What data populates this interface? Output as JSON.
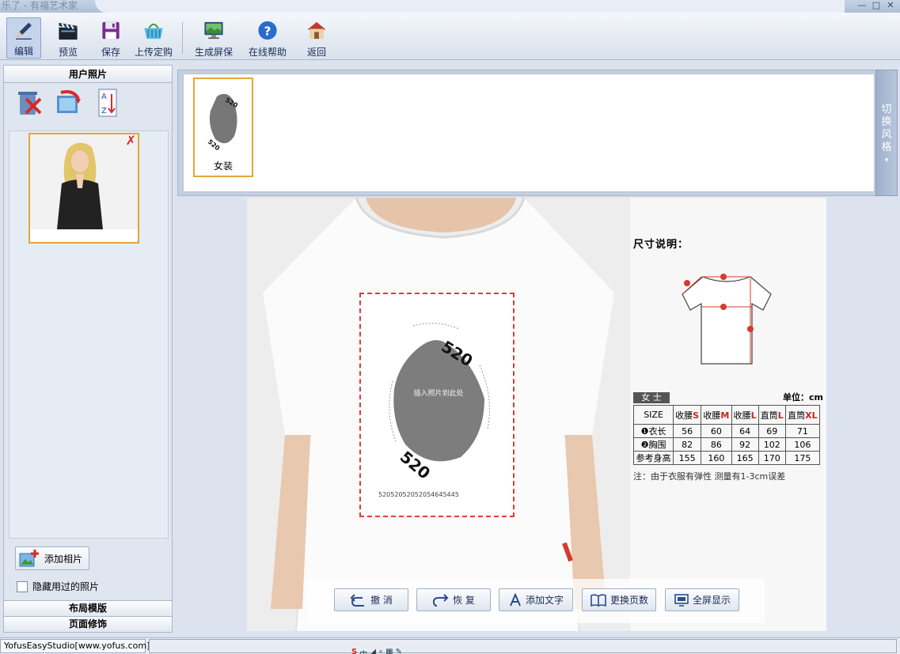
{
  "window": {
    "title": "乐了 - 有福艺术家"
  },
  "toolbar": {
    "items": [
      {
        "label": "编辑",
        "icon": "pencil-icon"
      },
      {
        "label": "预览",
        "icon": "clapper-icon"
      },
      {
        "label": "保存",
        "icon": "floppy-icon"
      },
      {
        "label": "上传定购",
        "icon": "basket-icon"
      },
      {
        "label": "生成屏保",
        "icon": "monitor-icon"
      },
      {
        "label": "在线帮助",
        "icon": "help-icon"
      },
      {
        "label": "返回",
        "icon": "home-icon"
      }
    ]
  },
  "left_panel": {
    "header": "用户照片",
    "add_photo_label": "添加相片",
    "hide_used_label": "隐藏用过的照片",
    "section_layout": "布局模版",
    "section_decor": "页面修饰"
  },
  "style_strip": {
    "thumb_label": "女装",
    "switch_label": [
      "切",
      "换",
      "风",
      "格"
    ]
  },
  "design": {
    "placeholder_text": "插入照片到此处",
    "deco_number": "520",
    "deco_digits": "52052052052054645445"
  },
  "size_chart": {
    "title": "尺寸说明：",
    "gender": "女 士",
    "unit": "单位：cm",
    "header": [
      {
        "text": "SIZE",
        "red": ""
      },
      {
        "text": "收腰",
        "red": "S"
      },
      {
        "text": "收腰",
        "red": "M"
      },
      {
        "text": "收腰",
        "red": "L"
      },
      {
        "text": "直筒",
        "red": "L"
      },
      {
        "text": "直筒",
        "red": "XL"
      }
    ],
    "rows": [
      {
        "name": "❶衣长",
        "values": [
          "56",
          "60",
          "64",
          "69",
          "71"
        ]
      },
      {
        "name": "❷胸围",
        "values": [
          "82",
          "86",
          "92",
          "102",
          "106"
        ]
      },
      {
        "name": "参考身高",
        "values": [
          "155",
          "160",
          "165",
          "170",
          "175"
        ]
      }
    ],
    "note": "注：由于衣服有弹性 测量有1-3cm误差"
  },
  "actions": [
    {
      "label": "撤 消"
    },
    {
      "label": "恢 复"
    },
    {
      "label": "添加文字"
    },
    {
      "label": "更换页数"
    },
    {
      "label": "全屏显示"
    }
  ],
  "status": {
    "text": "YofusEasyStudio[www.yofus.com]"
  },
  "colors": {
    "accent": "#e4a63a",
    "dashed": "#e23a3a",
    "toolbar_text": "#1a2a55"
  }
}
